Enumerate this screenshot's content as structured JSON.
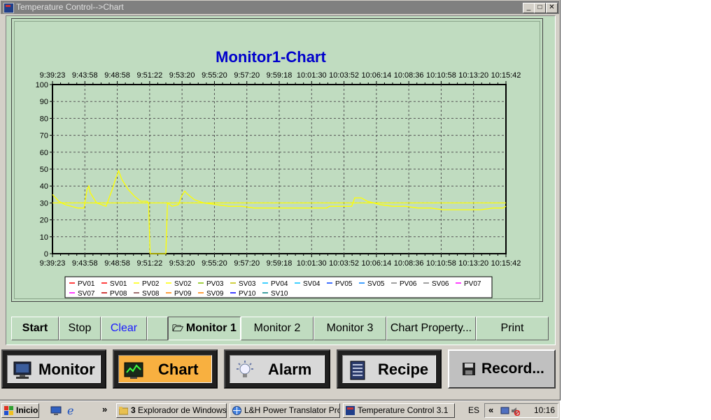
{
  "window": {
    "title": "Temperature Control-->Chart",
    "minimize": "_",
    "maximize": "□",
    "close": "✕"
  },
  "colors": {
    "panel": "#c0dcc0",
    "trace": "#ffff00",
    "title": "#0000cc",
    "chart_button_accent": "#f8b040"
  },
  "chart_data": {
    "type": "line",
    "title": "Monitor1-Chart",
    "time_ticks": [
      "9:39:23",
      "9:43:58",
      "9:48:58",
      "9:51:22",
      "9:53:20",
      "9:55:20",
      "9:57:20",
      "9:59:18",
      "10:01:30",
      "10:03:52",
      "10:06:14",
      "10:08:36",
      "10:10:58",
      "10:13:20",
      "10:15:42"
    ],
    "y_ticks": [
      "100",
      "90",
      "80",
      "70",
      "60",
      "50",
      "40",
      "30",
      "20",
      "10",
      "0"
    ],
    "ylim": [
      0,
      100
    ],
    "grid": true,
    "legend_position": "bottom",
    "legend": [
      "PV01",
      "SV01",
      "PV02",
      "SV02",
      "PV03",
      "SV03",
      "PV04",
      "SV04",
      "PV05",
      "SV05",
      "PV06",
      "SV06",
      "PV07",
      "SV07",
      "PV08",
      "SV08",
      "PV09",
      "SV09",
      "PV10",
      "SV10"
    ],
    "legend_colors": [
      "#ff0000",
      "#ff0000",
      "#ffff00",
      "#ffff00",
      "#80c000",
      "#c0c000",
      "#00c0ff",
      "#00c0ff",
      "#0040ff",
      "#0080ff",
      "#808080",
      "#808080",
      "#ff00ff",
      "#ff00ff",
      "#c00000",
      "#804040",
      "#ff8000",
      "#ff8000",
      "#0000ff",
      "#008080"
    ],
    "series": [
      {
        "name": "PV02",
        "points": [
          [
            0,
            35
          ],
          [
            2,
            31
          ],
          [
            4,
            29
          ],
          [
            6,
            28
          ],
          [
            8,
            27
          ],
          [
            10,
            27
          ],
          [
            11,
            38
          ],
          [
            11.5,
            40
          ],
          [
            12,
            36
          ],
          [
            14,
            30
          ],
          [
            17,
            28
          ],
          [
            19,
            38
          ],
          [
            20,
            44
          ],
          [
            21,
            49
          ],
          [
            22,
            44
          ],
          [
            24,
            38
          ],
          [
            26,
            34
          ],
          [
            28,
            31
          ],
          [
            30,
            31
          ],
          [
            30.5,
            30
          ],
          [
            31,
            0
          ],
          [
            36,
            0
          ],
          [
            36.5,
            30
          ],
          [
            38,
            28
          ],
          [
            40,
            29
          ],
          [
            41,
            34
          ],
          [
            42,
            37
          ],
          [
            43,
            35
          ],
          [
            45,
            32
          ],
          [
            48,
            30
          ],
          [
            52,
            29
          ],
          [
            56,
            28
          ],
          [
            60,
            28
          ],
          [
            64,
            27
          ],
          [
            70,
            27
          ],
          [
            76,
            27
          ],
          [
            82,
            27
          ],
          [
            87,
            27
          ],
          [
            88,
            28
          ],
          [
            92,
            28
          ],
          [
            95,
            28
          ],
          [
            96,
            33
          ],
          [
            98,
            33
          ],
          [
            100,
            31
          ],
          [
            102,
            30
          ],
          [
            104,
            29
          ],
          [
            108,
            28
          ],
          [
            112,
            28
          ],
          [
            116,
            27
          ],
          [
            120,
            27
          ],
          [
            124,
            26
          ],
          [
            128,
            26
          ],
          [
            132,
            26
          ],
          [
            136,
            26
          ],
          [
            140,
            27
          ],
          [
            143,
            27
          ],
          [
            144,
            28
          ]
        ]
      },
      {
        "name": "SV02",
        "points": [
          [
            0,
            30
          ],
          [
            144,
            30
          ]
        ]
      }
    ]
  },
  "controls": {
    "start": "Start",
    "stop": "Stop",
    "clear": "Clear"
  },
  "tabs": [
    {
      "label": "Monitor 1",
      "icon": "folder-open-icon"
    },
    {
      "label": "Monitor 2"
    },
    {
      "label": "Monitor 3"
    }
  ],
  "chart_property": "Chart Property...",
  "print": "Print",
  "nav": {
    "monitor": "Monitor",
    "chart": "Chart",
    "alarm": "Alarm",
    "recipe": "Recipe",
    "record": "Record..."
  },
  "taskbar": {
    "start": "Inicio",
    "explorer": "Explorador de Windows",
    "explorer_count": "3",
    "translator": "L&H Power Translator Pro...",
    "tempcontrol": "Temperature Control 3.1",
    "lang": "ES",
    "chevron": "«",
    "quick_chevron": "»",
    "clock": "10:16"
  }
}
